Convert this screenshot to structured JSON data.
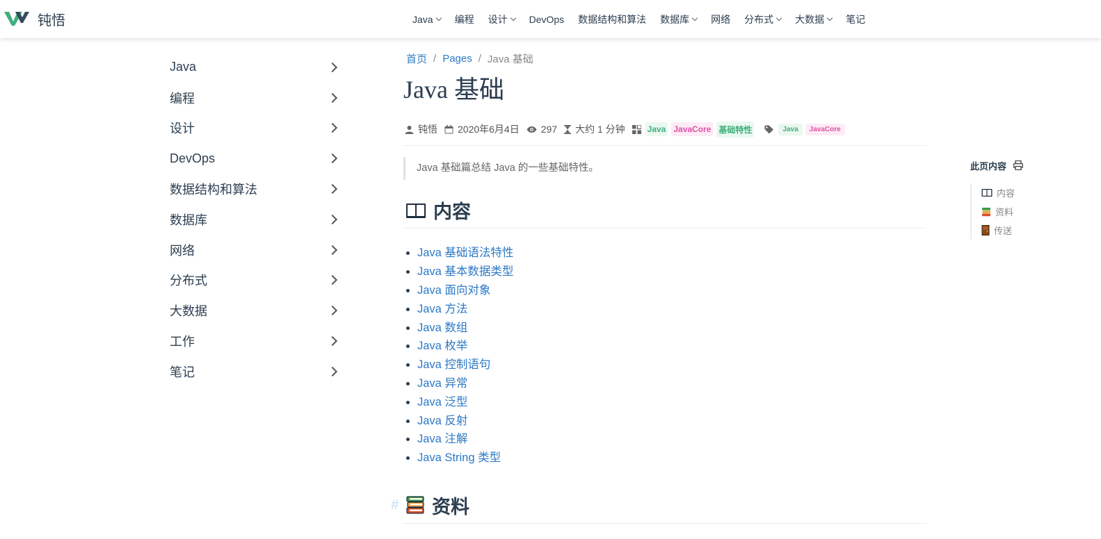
{
  "brand": {
    "name": "钝悟"
  },
  "nav": [
    {
      "label": "Java",
      "dropdown": true
    },
    {
      "label": "编程",
      "dropdown": false
    },
    {
      "label": "设计",
      "dropdown": true
    },
    {
      "label": "DevOps",
      "dropdown": false
    },
    {
      "label": "数据结构和算法",
      "dropdown": false
    },
    {
      "label": "数据库",
      "dropdown": true
    },
    {
      "label": "网络",
      "dropdown": false
    },
    {
      "label": "分布式",
      "dropdown": true
    },
    {
      "label": "大数据",
      "dropdown": true
    },
    {
      "label": "笔记",
      "dropdown": false
    }
  ],
  "sidebar": {
    "items": [
      {
        "label": "Java"
      },
      {
        "label": "编程"
      },
      {
        "label": "设计"
      },
      {
        "label": "DevOps"
      },
      {
        "label": "数据结构和算法"
      },
      {
        "label": "数据库"
      },
      {
        "label": "网络"
      },
      {
        "label": "分布式"
      },
      {
        "label": "大数据"
      },
      {
        "label": "工作"
      },
      {
        "label": "笔记"
      }
    ]
  },
  "breadcrumb": {
    "home": "首页",
    "sep": "/",
    "pages": "Pages",
    "current": "Java 基础"
  },
  "page": {
    "title": "Java 基础",
    "author": "钝悟",
    "date": "2020年6月4日",
    "views": "297",
    "reading_time": "大约 1 分钟",
    "categories": [
      "Java",
      "JavaCore",
      "基础特性"
    ],
    "tags": [
      "Java",
      "JavaCore"
    ],
    "summary": "Java 基础篇总结 Java 的一些基础特性。",
    "section1": "内容",
    "section2": "资料",
    "anchor": "#",
    "links": [
      "Java 基础语法特性",
      "Java 基本数据类型",
      "Java 面向对象",
      "Java 方法",
      "Java 数组",
      "Java 枚举",
      "Java 控制语句",
      "Java 异常",
      "Java 泛型",
      "Java 反射",
      "Java 注解",
      "Java String 类型"
    ]
  },
  "toc": {
    "title": "此页内容",
    "items": [
      "内容",
      "资料",
      "传送"
    ]
  },
  "colors": {
    "accent": "#2e79c5",
    "brand_green": "#3eaf7c",
    "tag_pink": "#e24ea6"
  }
}
